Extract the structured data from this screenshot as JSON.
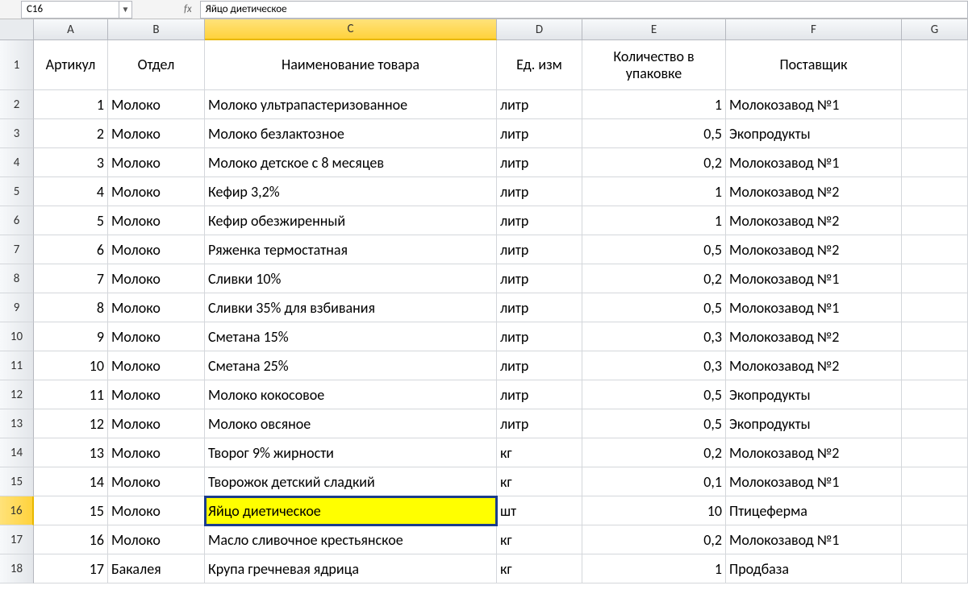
{
  "formula_bar": {
    "cell_ref": "C16",
    "fx_label": "fx",
    "formula_value": "Яйцо диетическое"
  },
  "columns": [
    {
      "letter": "A",
      "class": "col-A",
      "selected": false
    },
    {
      "letter": "B",
      "class": "col-B",
      "selected": false
    },
    {
      "letter": "C",
      "class": "col-C",
      "selected": true
    },
    {
      "letter": "D",
      "class": "col-D",
      "selected": false
    },
    {
      "letter": "E",
      "class": "col-E",
      "selected": false
    },
    {
      "letter": "F",
      "class": "col-F",
      "selected": false
    },
    {
      "letter": "G",
      "class": "col-G",
      "selected": false
    }
  ],
  "headers": {
    "A": "Артикул",
    "B": "Отдел",
    "C": "Наименование товара",
    "D": "Ед. изм",
    "E": "Количество в упаковке",
    "F": "Поставщик"
  },
  "rows": [
    {
      "num": 1,
      "header": true
    },
    {
      "num": 2,
      "A": "1",
      "B": "Молоко",
      "C": "Молоко ультрапастеризованное",
      "D": "литр",
      "E": "1",
      "F": "Молокозавод №1"
    },
    {
      "num": 3,
      "A": "2",
      "B": "Молоко",
      "C": "Молоко безлактозное",
      "D": "литр",
      "E": "0,5",
      "F": "Экопродукты"
    },
    {
      "num": 4,
      "A": "3",
      "B": "Молоко",
      "C": "Молоко детское с 8 месяцев",
      "D": "литр",
      "E": "0,2",
      "F": "Молокозавод №1"
    },
    {
      "num": 5,
      "A": "4",
      "B": "Молоко",
      "C": "Кефир 3,2%",
      "D": "литр",
      "E": "1",
      "F": "Молокозавод №2"
    },
    {
      "num": 6,
      "A": "5",
      "B": "Молоко",
      "C": "Кефир обезжиренный",
      "D": "литр",
      "E": "1",
      "F": "Молокозавод №2"
    },
    {
      "num": 7,
      "A": "6",
      "B": "Молоко",
      "C": "Ряженка термостатная",
      "D": "литр",
      "E": "0,5",
      "F": "Молокозавод №2"
    },
    {
      "num": 8,
      "A": "7",
      "B": "Молоко",
      "C": "Сливки 10%",
      "D": "литр",
      "E": "0,2",
      "F": "Молокозавод №1"
    },
    {
      "num": 9,
      "A": "8",
      "B": "Молоко",
      "C": "Сливки 35% для взбивания",
      "D": "литр",
      "E": "0,5",
      "F": "Молокозавод №1"
    },
    {
      "num": 10,
      "A": "9",
      "B": "Молоко",
      "C": "Сметана 15%",
      "D": "литр",
      "E": "0,3",
      "F": "Молокозавод №2"
    },
    {
      "num": 11,
      "A": "10",
      "B": "Молоко",
      "C": "Сметана 25%",
      "D": "литр",
      "E": "0,3",
      "F": "Молокозавод №2"
    },
    {
      "num": 12,
      "A": "11",
      "B": "Молоко",
      "C": "Молоко кокосовое",
      "D": "литр",
      "E": "0,5",
      "F": "Экопродукты"
    },
    {
      "num": 13,
      "A": "12",
      "B": "Молоко",
      "C": "Молоко овсяное",
      "D": "литр",
      "E": "0,5",
      "F": "Экопродукты"
    },
    {
      "num": 14,
      "A": "13",
      "B": "Молоко",
      "C": "Творог 9% жирности",
      "D": "кг",
      "E": "0,2",
      "F": "Молокозавод №2"
    },
    {
      "num": 15,
      "A": "14",
      "B": "Молоко",
      "C": "Творожок детский сладкий",
      "D": "кг",
      "E": "0,1",
      "F": "Молокозавод №1"
    },
    {
      "num": 16,
      "A": "15",
      "B": "Молоко",
      "C": "Яйцо диетическое",
      "D": "шт",
      "E": "10",
      "F": "Птицеферма",
      "selected": true
    },
    {
      "num": 17,
      "A": "16",
      "B": "Молоко",
      "C": "Масло сливочное крестьянское",
      "D": "кг",
      "E": "0,2",
      "F": "Молокозавод №1"
    },
    {
      "num": 18,
      "A": "17",
      "B": "Бакалея",
      "C": "Крупа гречневая ядрица",
      "D": "кг",
      "E": "1",
      "F": "Продбаза"
    }
  ],
  "active_cell": {
    "row": 16,
    "col": "C"
  }
}
